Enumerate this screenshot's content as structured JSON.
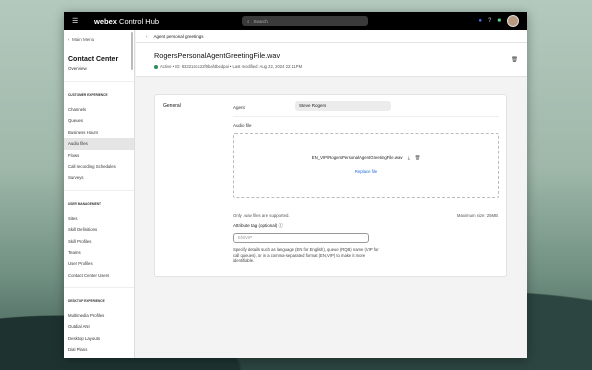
{
  "topbar": {
    "logo_bold": "webex",
    "logo_rest": " Control Hub",
    "search_placeholder": "Search"
  },
  "sidebar": {
    "back": "Main Menu",
    "title": "Contact Center",
    "overview": "Overview",
    "sections": [
      {
        "heading": "Customer Experience",
        "items": [
          "Channels",
          "Queues",
          "Business Hours",
          "Audio files",
          "Flows",
          "Call recording Schedules",
          "Surveys"
        ]
      },
      {
        "heading": "User Management",
        "items": [
          "Sites",
          "Skill Definitions",
          "Skill Profiles",
          "Teams",
          "User Profiles",
          "Contact Center Users"
        ]
      },
      {
        "heading": "Desktop Experience",
        "items": [
          "Multimedia Profiles",
          "Outdial ANI",
          "Desktop Layouts",
          "Dial Plans"
        ]
      }
    ],
    "active": "Audio files"
  },
  "breadcrumb": "Agent personal greetings",
  "header": {
    "title": "RogersPersonalAgentGreetingFile.wav",
    "status": "Active",
    "meta": " •  ID: 833214cc22f0baf4bedpai  •  Last modified: Aug 22, 2024 22:11PM"
  },
  "form": {
    "section": "General",
    "agent_label": "Agent",
    "agent_value": "Steve Rogers",
    "audio_label": "Audio file",
    "file_name": "EN_VIP/RogersPersonalAgentGreetingFile.wav",
    "replace": "Replace file",
    "only_wav": "Only .wav files are supported.",
    "max_size": "Maximum size: 25MB",
    "tag_label": "Attribute tag (optional)",
    "tag_placeholder": "EN/VIP",
    "help": "Specify details such as language (EN for English), queue (RQB) name (VIP for call queues), or in a comma-separated format (EN,VIP) to make it more identifiable."
  }
}
